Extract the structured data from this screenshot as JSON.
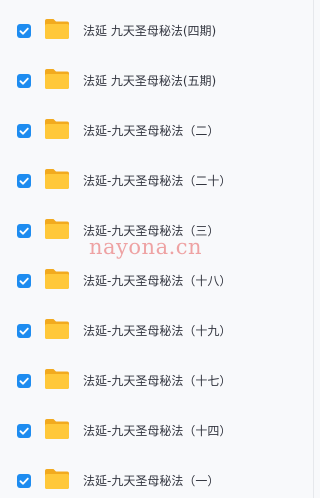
{
  "colors": {
    "checkbox": "#1e8cf0",
    "folder_front": "#ffc83a",
    "folder_back": "#f2aa1f",
    "label_text": "#333640",
    "watermark": "#e86c6c"
  },
  "icons": {
    "checkbox": "checkmark-icon",
    "item": "folder-icon"
  },
  "items": [
    {
      "label": "法延 九天圣母秘法(四期)",
      "checked": true
    },
    {
      "label": "法延 九天圣母秘法(五期)",
      "checked": true
    },
    {
      "label": "法延-九天圣母秘法（二）",
      "checked": true
    },
    {
      "label": "法延-九天圣母秘法（二十）",
      "checked": true
    },
    {
      "label": "法延-九天圣母秘法（三）",
      "checked": true
    },
    {
      "label": "法延-九天圣母秘法（十八）",
      "checked": true
    },
    {
      "label": "法延-九天圣母秘法（十九）",
      "checked": true
    },
    {
      "label": "法延-九天圣母秘法（十七）",
      "checked": true
    },
    {
      "label": "法延-九天圣母秘法（十四）",
      "checked": true
    },
    {
      "label": "法延-九天圣母秘法（一）",
      "checked": true
    }
  ],
  "watermark": "nayona.cn"
}
